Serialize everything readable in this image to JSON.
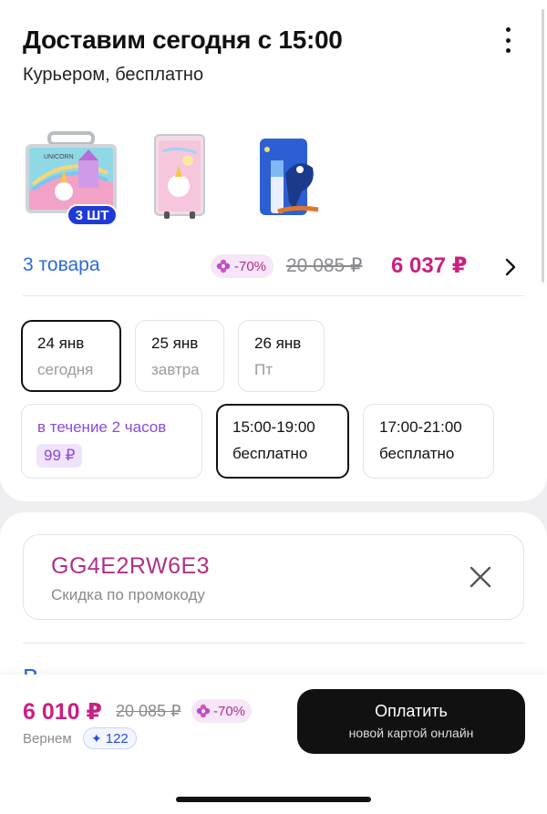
{
  "delivery": {
    "title": "Доставим сегодня с 15:00",
    "subtitle": "Курьером, бесплатно",
    "qty_badge": "3 ШТ",
    "items_link": "3 товара",
    "discount_badge": "-70%",
    "old_price": "20 085 ₽",
    "new_price": "6 037 ₽"
  },
  "dates": [
    {
      "day": "24 янв",
      "label": "сегодня",
      "selected": true
    },
    {
      "day": "25 янв",
      "label": "завтра",
      "selected": false
    },
    {
      "day": "26 янв",
      "label": "Пт",
      "selected": false
    }
  ],
  "time_slots": [
    {
      "title": "в течение 2 часов",
      "price": "99 ₽",
      "selected": false
    },
    {
      "title": "15:00-19:00",
      "price": "бесплатно",
      "selected": true
    },
    {
      "title": "17:00-21:00",
      "price": "бесплатно",
      "selected": false
    }
  ],
  "promo": {
    "code": "GG4E2RW6E3",
    "label": "Скидка по промокоду"
  },
  "footer": {
    "total": "6 010 ₽",
    "old_total": "20 085 ₽",
    "discount_badge": "-70%",
    "cashback_label": "Вернем",
    "bonus_points": "122",
    "pay_title": "Оплатить",
    "pay_subtitle": "новой картой онлайн"
  },
  "colors": {
    "accent_pink": "#cb1f82",
    "link_blue": "#2b6ad8",
    "qty_badge_blue": "#1e3bd8",
    "express_purple": "#8b4ad8"
  }
}
